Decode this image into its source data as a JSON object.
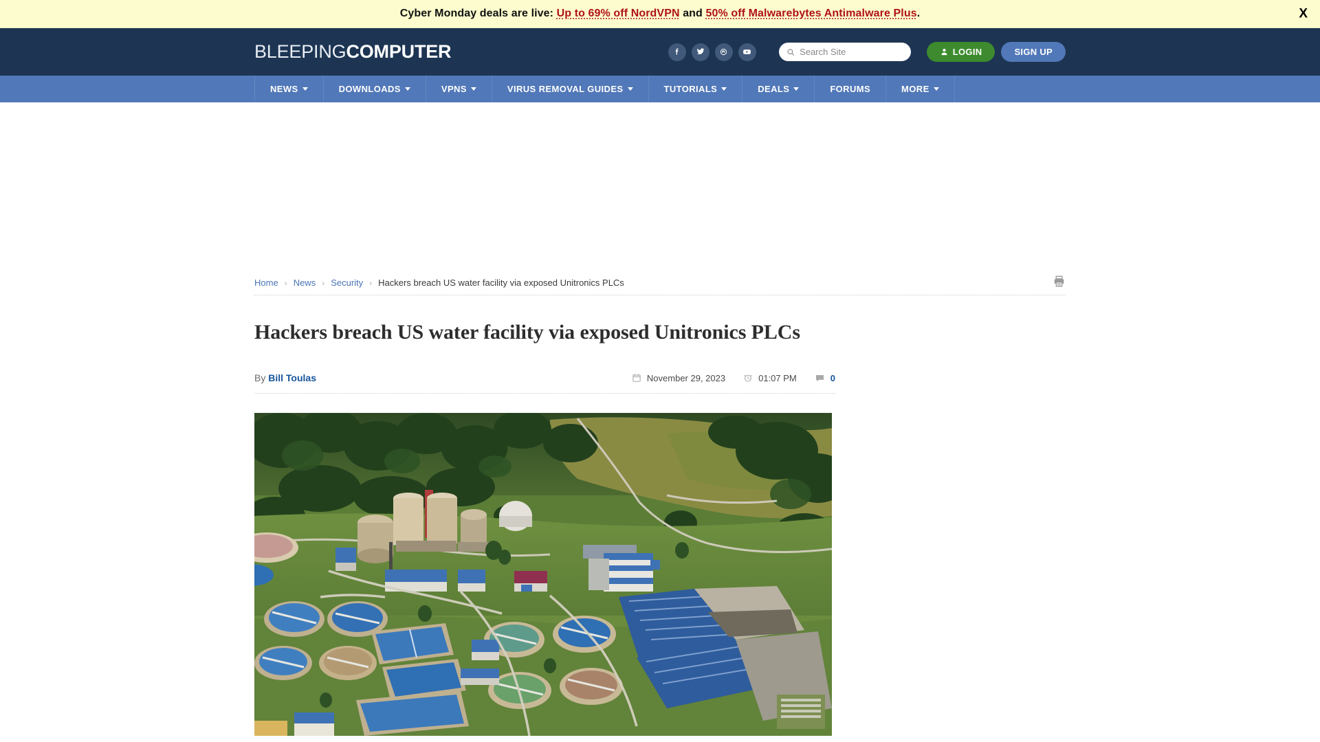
{
  "promo": {
    "prefix": "Cyber Monday deals are live:",
    "link1": "Up to 69% off NordVPN",
    "middle": "and",
    "link2": "50% off Malwarebytes Antimalware Plus",
    "suffix": ".",
    "close_label": "X",
    "bg_color": "#fcfcce",
    "link_color": "#b01116"
  },
  "header": {
    "logo_light": "BLEEPING",
    "logo_bold": "COMPUTER",
    "bg_color": "#1d3553",
    "social": [
      {
        "name": "facebook-icon",
        "label": "Facebook"
      },
      {
        "name": "twitter-icon",
        "label": "Twitter"
      },
      {
        "name": "mastodon-icon",
        "label": "Mastodon"
      },
      {
        "name": "youtube-icon",
        "label": "YouTube"
      }
    ],
    "search": {
      "placeholder": "Search Site",
      "value": ""
    },
    "login_label": "LOGIN",
    "signup_label": "SIGN UP",
    "login_color": "#3d8b2e",
    "signup_color": "#5178b8"
  },
  "nav": {
    "bg_color": "#5178b8",
    "items": [
      {
        "label": "NEWS",
        "has_caret": true
      },
      {
        "label": "DOWNLOADS",
        "has_caret": true
      },
      {
        "label": "VPNS",
        "has_caret": true
      },
      {
        "label": "VIRUS REMOVAL GUIDES",
        "has_caret": true
      },
      {
        "label": "TUTORIALS",
        "has_caret": true
      },
      {
        "label": "DEALS",
        "has_caret": true
      },
      {
        "label": "FORUMS",
        "has_caret": false
      },
      {
        "label": "MORE",
        "has_caret": true
      }
    ]
  },
  "breadcrumb": {
    "items": [
      {
        "label": "Home",
        "link": true
      },
      {
        "label": "News",
        "link": true
      },
      {
        "label": "Security",
        "link": true
      },
      {
        "label": "Hackers breach US water facility via exposed Unitronics PLCs",
        "link": false
      }
    ],
    "separator": "›"
  },
  "article": {
    "title": "Hackers breach US water facility via exposed Unitronics PLCs",
    "by_prefix": "By",
    "author": "Bill Toulas",
    "date": "November 29, 2023",
    "time": "01:07 PM",
    "comments": "0",
    "hero_alt": "Aerial view of a water treatment facility with circular clarifier tanks, storage silos and blue-roofed buildings"
  }
}
